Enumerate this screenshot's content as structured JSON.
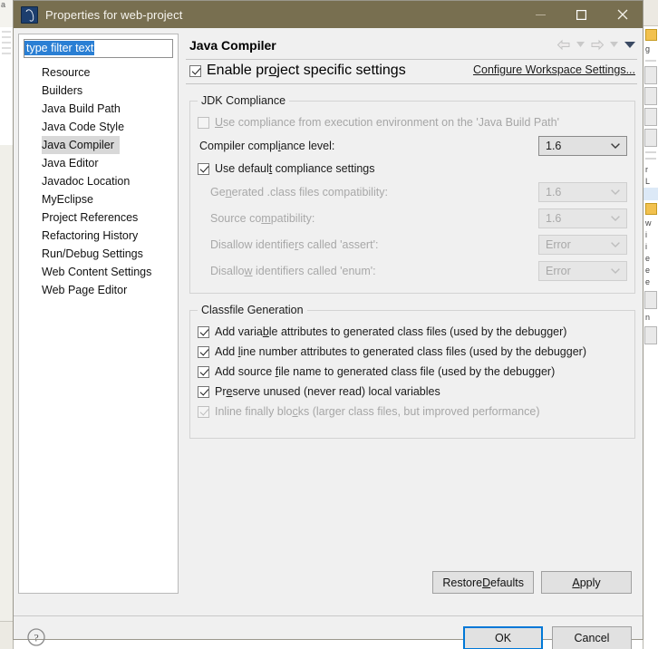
{
  "window": {
    "title": "Properties for web-project",
    "icon": "eclipse-properties-icon",
    "controls": {
      "minimize": "minimize-icon",
      "maximize": "maximize-icon",
      "close": "close-icon"
    },
    "titlebar_color": "#786f50"
  },
  "sidebar": {
    "filter": {
      "value": "type filter text",
      "placeholder": "type filter text",
      "selected": true
    },
    "items": [
      {
        "label": "Resource",
        "selected": false
      },
      {
        "label": "Builders",
        "selected": false
      },
      {
        "label": "Java Build Path",
        "selected": false
      },
      {
        "label": "Java Code Style",
        "selected": false
      },
      {
        "label": "Java Compiler",
        "selected": true
      },
      {
        "label": "Java Editor",
        "selected": false
      },
      {
        "label": "Javadoc Location",
        "selected": false
      },
      {
        "label": "MyEclipse",
        "selected": false
      },
      {
        "label": "Project References",
        "selected": false
      },
      {
        "label": "Refactoring History",
        "selected": false
      },
      {
        "label": "Run/Debug Settings",
        "selected": false
      },
      {
        "label": "Web Content Settings",
        "selected": false
      },
      {
        "label": "Web Page Editor",
        "selected": false
      }
    ]
  },
  "page": {
    "title": "Java Compiler",
    "nav": {
      "back": "back-arrow-icon",
      "back_menu": "chevron-down-icon",
      "forward": "forward-arrow-icon",
      "forward_menu": "chevron-down-icon",
      "view_menu": "chevron-down-icon"
    },
    "enable_project_specific": {
      "label_pre": "Enable pr",
      "label_mnemonic": "o",
      "label_post": "ject specific settings",
      "checked": true,
      "enabled": true
    },
    "configure_workspace_link": "Configure Workspace Settings...",
    "jdk_compliance": {
      "title": "JDK Compliance",
      "use_execution_env": {
        "label_pre": "",
        "label_mnemonic": "U",
        "label_post": "se compliance from execution environment on the 'Java Build Path'",
        "checked": false,
        "enabled": false
      },
      "compiler_compliance_level": {
        "label_pre": "Compiler compl",
        "label_mnemonic": "i",
        "label_post": "ance level:",
        "value": "1.6",
        "enabled": true
      },
      "use_default_compliance": {
        "label_pre": "Use defaul",
        "label_mnemonic": "t",
        "label_post": " compliance settings",
        "checked": true,
        "enabled": true
      },
      "generated_class_compat": {
        "label_pre": "Ge",
        "label_mnemonic": "n",
        "label_post": "erated .class files compatibility:",
        "value": "1.6",
        "enabled": false
      },
      "source_compat": {
        "label_pre": "Source co",
        "label_mnemonic": "m",
        "label_post": "patibility:",
        "value": "1.6",
        "enabled": false
      },
      "disallow_assert": {
        "label_pre": "Disallow identifie",
        "label_mnemonic": "r",
        "label_post": "s called 'assert':",
        "value": "Error",
        "enabled": false
      },
      "disallow_enum": {
        "label_pre": "Disallo",
        "label_mnemonic": "w",
        "label_post": " identifiers called 'enum':",
        "value": "Error",
        "enabled": false
      }
    },
    "classfile_generation": {
      "title": "Classfile Generation",
      "options": [
        {
          "label_pre": "Add varia",
          "label_mnemonic": "b",
          "label_post": "le attributes to generated class files (used by the debugger)",
          "checked": true,
          "enabled": true
        },
        {
          "label_pre": "Add ",
          "label_mnemonic": "l",
          "label_post": "ine number attributes to generated class files (used by the debugger)",
          "checked": true,
          "enabled": true
        },
        {
          "label_pre": "Add source ",
          "label_mnemonic": "f",
          "label_post": "ile name to generated class file (used by the debugger)",
          "checked": true,
          "enabled": true
        },
        {
          "label_pre": "Pr",
          "label_mnemonic": "e",
          "label_post": "serve unused (never read) local variables",
          "checked": true,
          "enabled": true
        },
        {
          "label_pre": "Inline finally blo",
          "label_mnemonic": "c",
          "label_post": "ks (larger class files, but improved performance)",
          "checked": true,
          "enabled": false
        }
      ]
    },
    "restore_defaults": {
      "label_pre": "Restore ",
      "label_mnemonic": "D",
      "label_post": "efaults"
    },
    "apply": {
      "label_pre": "",
      "label_mnemonic": "A",
      "label_post": "pply"
    }
  },
  "footer": {
    "help": "help-icon",
    "ok": "OK",
    "cancel": "Cancel",
    "default_button": "OK",
    "focus_color": "#0078d7"
  }
}
